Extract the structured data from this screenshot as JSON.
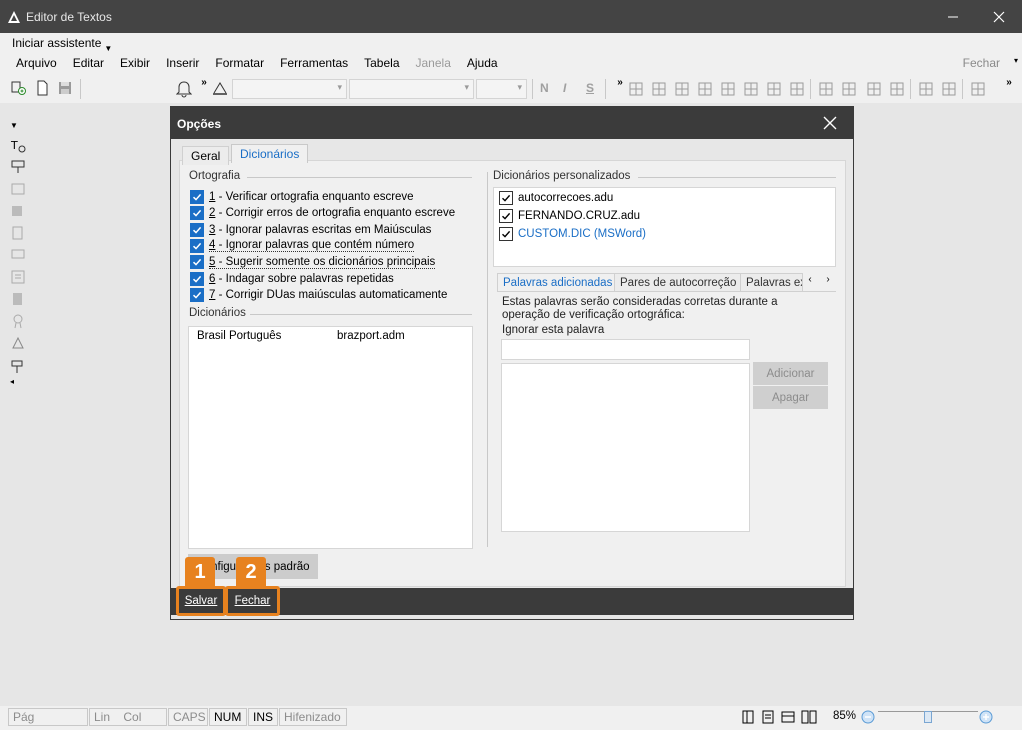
{
  "window": {
    "title": "Editor de Textos"
  },
  "assistant": {
    "label": "Iniciar assistente"
  },
  "menu": [
    {
      "label": "Arquivo",
      "enabled": true
    },
    {
      "label": "Editar",
      "enabled": true
    },
    {
      "label": "Exibir",
      "enabled": true
    },
    {
      "label": "Inserir",
      "enabled": true
    },
    {
      "label": "Formatar",
      "enabled": true
    },
    {
      "label": "Ferramentas",
      "enabled": true
    },
    {
      "label": "Tabela",
      "enabled": true
    },
    {
      "label": "Janela",
      "enabled": false
    },
    {
      "label": "Ajuda",
      "enabled": true
    }
  ],
  "top_close": "Fechar",
  "toolbar": {
    "bold": "N",
    "italic": "I",
    "strike": "S"
  },
  "dialog": {
    "title": "Opções",
    "tabs": [
      {
        "label": "Geral",
        "active": false
      },
      {
        "label": "Dicionários",
        "active": true
      }
    ],
    "ortografia": {
      "label": "Ortografia",
      "options": [
        {
          "num": "1",
          "text": " - Verificar ortografia enquanto escreve",
          "checked": true
        },
        {
          "num": "2",
          "text": " - Corrigir erros de ortografia enquanto escreve",
          "checked": true
        },
        {
          "num": "3",
          "text": " - Ignorar palavras escritas em Maiúsculas",
          "checked": true
        },
        {
          "num": "4",
          "text": " - Ignorar palavras que contém número",
          "checked": true
        },
        {
          "num": "5",
          "text": " - Sugerir somente os dicionários principais",
          "checked": true
        },
        {
          "num": "6",
          "text": " - Indagar sobre palavras repetidas",
          "checked": true
        },
        {
          "num": "7",
          "text": " - Corrigir DUas maiúsculas automaticamente",
          "checked": true
        }
      ]
    },
    "dicionarios": {
      "label": "Dicionários",
      "rows": [
        {
          "name": "Brasil Português",
          "file": "brazport.adm"
        }
      ]
    },
    "config_button": "Configurações padrão",
    "personalizados": {
      "label": "Dicionários personalizados",
      "items": [
        {
          "label": "autocorrecoes.adu",
          "checked": true
        },
        {
          "label": "FERNANDO.CRUZ.adu",
          "checked": true
        },
        {
          "label": "CUSTOM.DIC (MSWord)",
          "checked": true
        }
      ]
    },
    "subtabs": [
      {
        "label": "Palavras adicionadas",
        "active": true
      },
      {
        "label": "Pares de autocorreção",
        "active": false
      },
      {
        "label": "Palavras ex",
        "active": false
      }
    ],
    "info_text": "Estas palavras serão consideradas corretas durante a operação de verificação ortográfica:",
    "ignore_label": "Ignorar esta palavra",
    "ignore_value": "",
    "add_button": "Adicionar",
    "delete_button": "Apagar",
    "footer": {
      "save": "Salvar",
      "close": "Fechar"
    },
    "badges": [
      "1",
      "2"
    ]
  },
  "status": {
    "pag": "Pág",
    "lin": "Lin",
    "col": "Col",
    "caps": "CAPS",
    "num": "NUM",
    "ins": "INS",
    "hif": "Hifenizado",
    "zoom": "85%",
    "zoom_level": 0.5
  }
}
